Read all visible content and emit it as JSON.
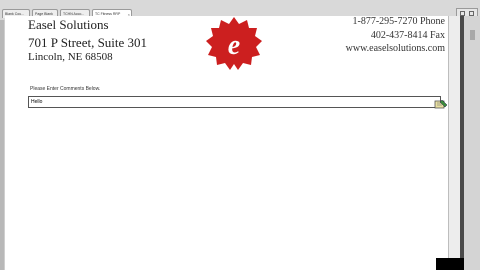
{
  "tabs": [
    {
      "label": "Blank Cou...",
      "active": false
    },
    {
      "label": "Page Blank",
      "active": false
    },
    {
      "label": "TCHN Acco...",
      "active": false
    },
    {
      "label": "TC Fitness RRP",
      "active": true
    }
  ],
  "letterhead": {
    "company": "Easel Solutions",
    "address_line1": "701 P Street, Suite 301",
    "address_line2": "Lincoln, NE 68508",
    "phone": "1-877-295-7270 Phone",
    "fax": "402-437-8414 Fax",
    "website": "www.easelsolutions.com",
    "logo_letter": "e"
  },
  "form": {
    "prompt": "Please Enter Comments Below.",
    "comment_value": "Hello"
  },
  "colors": {
    "logo_red": "#cc1f1f",
    "background_gray": "#cfcfcf"
  },
  "icons": {
    "tab_close": "close-icon",
    "cursor": "pencil-cursor-icon"
  }
}
